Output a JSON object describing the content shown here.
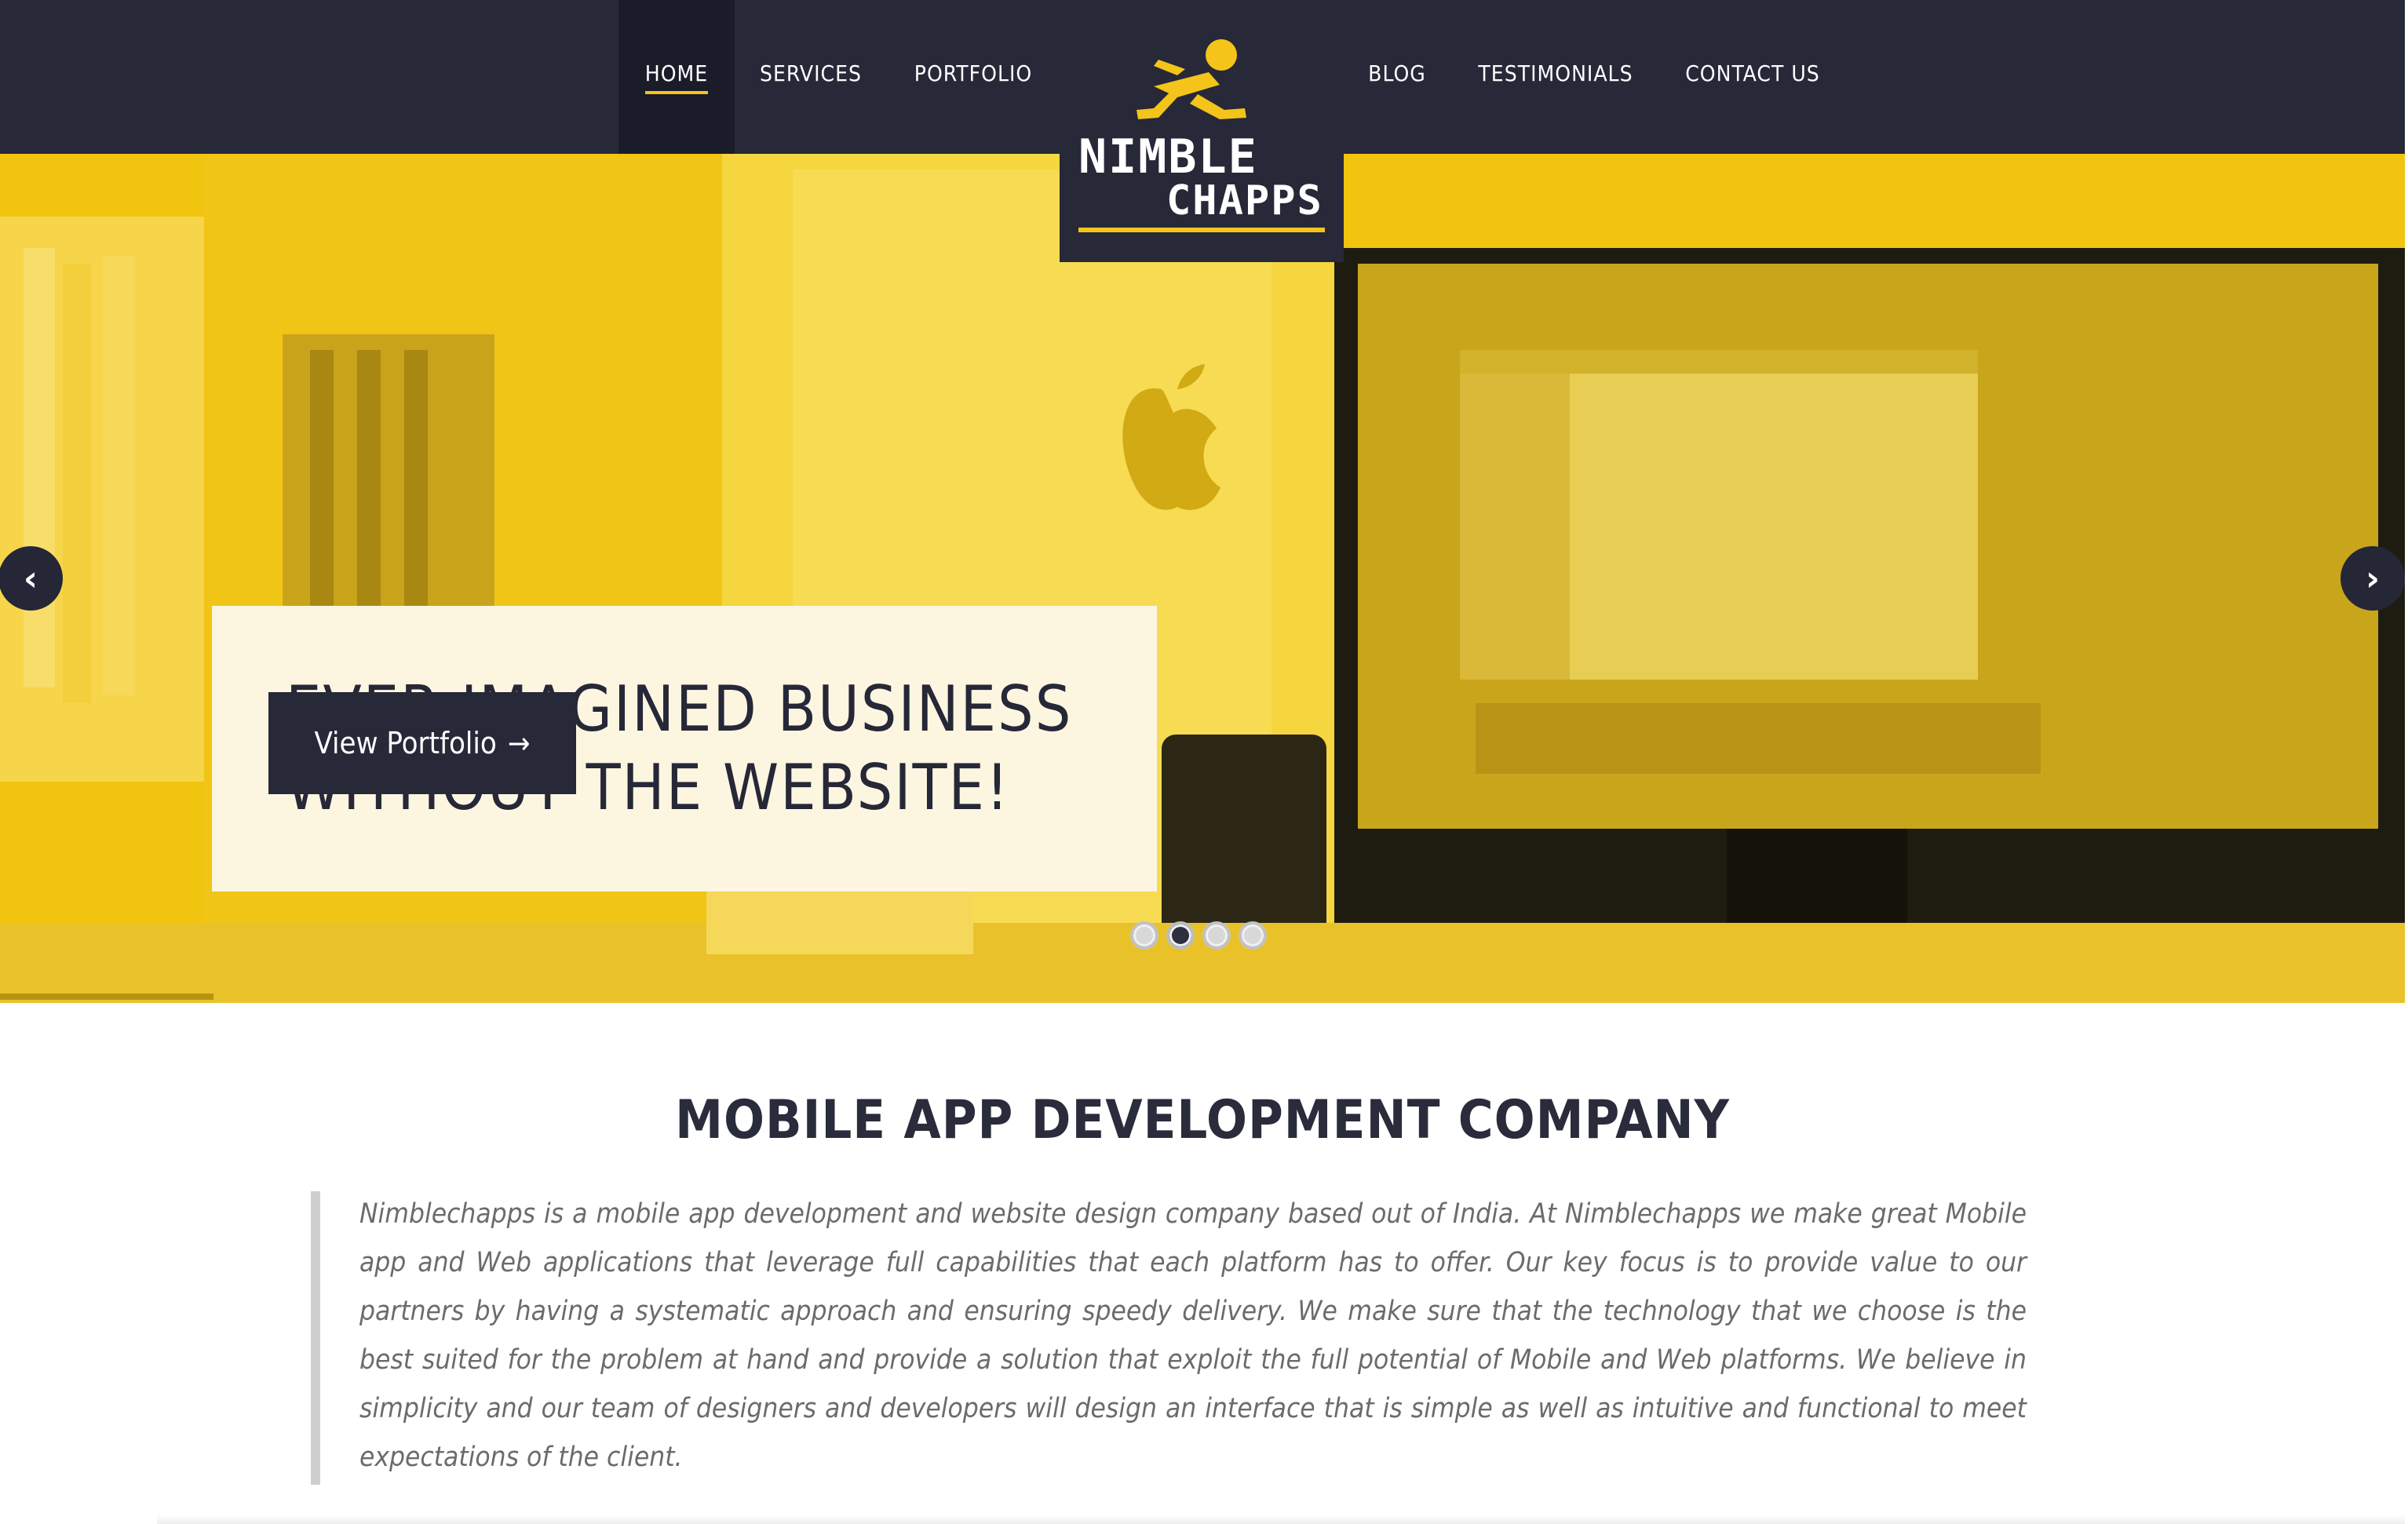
{
  "nav": {
    "items": [
      {
        "label": "HOME",
        "active": true
      },
      {
        "label": "SERVICES",
        "active": false
      },
      {
        "label": "PORTFOLIO",
        "active": false
      },
      {
        "label": "BLOG",
        "active": false
      },
      {
        "label": "TESTIMONIALS",
        "active": false
      },
      {
        "label": "CONTACT US",
        "active": false
      }
    ]
  },
  "logo": {
    "line1": "NIMBLE",
    "line2": "CHAPPS",
    "icon": "running-man-icon",
    "accent_color": "#f4c41a"
  },
  "hero": {
    "title_line1": "EVER IMAGINED BUSINESS",
    "title_line2": "WITHOUT THE WEBSITE!",
    "cta_label": "View Portfolio",
    "cta_arrow": "→",
    "prev_icon": "‹",
    "next_icon": "›",
    "slides_count": 4,
    "active_slide_index": 2,
    "background_color": "#f1c40f"
  },
  "intro": {
    "heading": "MOBILE APP DEVELOPMENT COMPANY",
    "paragraph": "Nimblechapps is a mobile app development and website design company based out of India. At Nimblechapps we make great Mobile app and Web applications that leverage full capabilities that each platform has to offer. Our key focus is to provide value to our partners by having a systematic approach  and ensuring speedy delivery. We make sure that the technology that we choose is the best suited for the problem at hand and provide a solution that exploit the full potential of Mobile and Web platforms. We believe in simplicity and our team of designers and developers will design an interface that is simple as well as intuitive and functional to meet expectations of the client."
  },
  "colors": {
    "nav_bg": "#272838",
    "accent": "#f4c41a",
    "text_dark": "#262737",
    "text_muted": "#6b6b6b"
  }
}
